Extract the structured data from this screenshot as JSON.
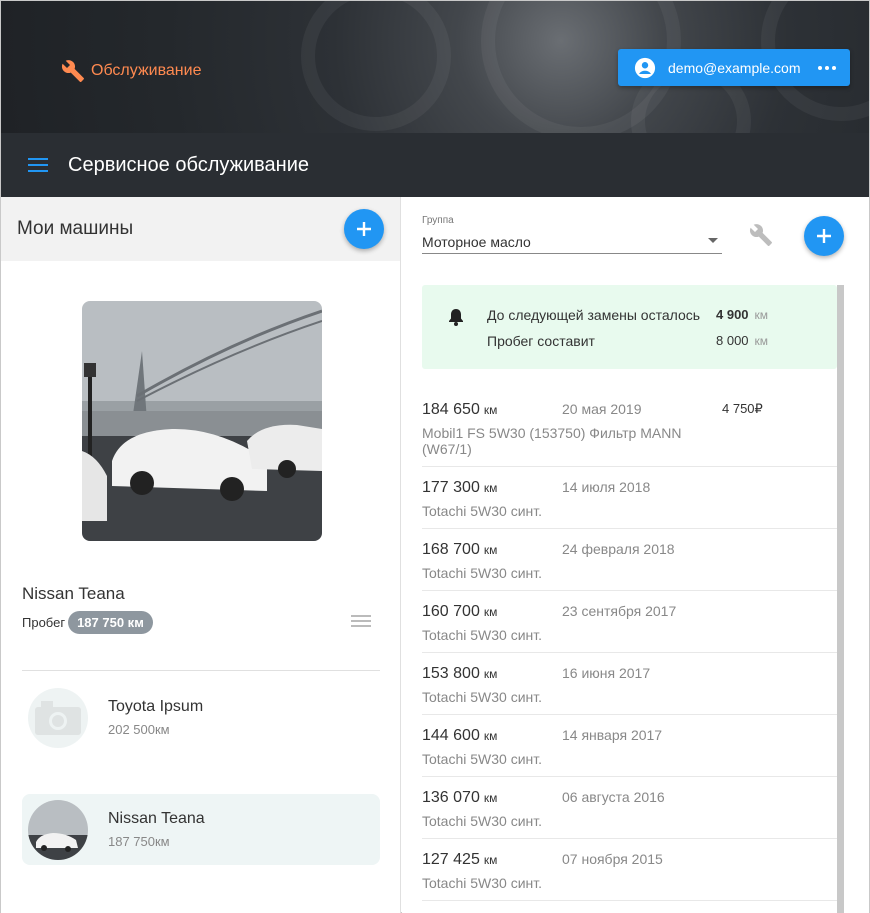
{
  "header": {
    "brand_label": "Обслуживание",
    "account_email": "demo@example.com"
  },
  "toolbar": {
    "title": "Сервисное обслуживание"
  },
  "cars_panel": {
    "title": "Мои машины",
    "current_car": {
      "name": "Nissan Teana",
      "mileage_label": "Пробег",
      "mileage_value": "187 750 км"
    },
    "list": [
      {
        "name": "Toyota Ipsum",
        "mileage": "202 500км",
        "selected": false
      },
      {
        "name": "Nissan Teana",
        "mileage": "187 750км",
        "selected": true
      }
    ]
  },
  "service_panel": {
    "group_label": "Группа",
    "group_value": "Моторное масло",
    "notice": {
      "line1_label": "До следующей замены осталось",
      "line1_value": "4 900",
      "line2_label": "Пробег составит",
      "line2_value": "8 000",
      "unit": "км"
    },
    "km_unit": "км",
    "records": [
      {
        "km": "184 650",
        "date": "20 мая 2019",
        "price": "4 750₽",
        "desc": "Mobil1 FS 5W30 (153750) Фильтр MANN (W67/1)"
      },
      {
        "km": "177 300",
        "date": "14 июля 2018",
        "price": "",
        "desc": "Totachi 5W30 синт."
      },
      {
        "km": "168 700",
        "date": "24 февраля 2018",
        "price": "",
        "desc": "Totachi 5W30 синт."
      },
      {
        "km": "160 700",
        "date": "23 сентября 2017",
        "price": "",
        "desc": "Totachi 5W30 синт."
      },
      {
        "km": "153 800",
        "date": "16 июня 2017",
        "price": "",
        "desc": "Totachi 5W30 синт."
      },
      {
        "km": "144 600",
        "date": "14 января 2017",
        "price": "",
        "desc": "Totachi 5W30 синт."
      },
      {
        "km": "136 070",
        "date": "06 августа 2016",
        "price": "",
        "desc": "Totachi 5W30 синт."
      },
      {
        "km": "127 425",
        "date": "07 ноября 2015",
        "price": "",
        "desc": "Totachi 5W30 синт."
      }
    ]
  },
  "icons": {
    "brand": "wrench-icon",
    "account": "account-circle-icon",
    "more": "more-horizontal-icon",
    "menu": "menu-icon",
    "add": "plus-icon",
    "list": "list-icon",
    "camera": "camera-icon",
    "bell": "bell-icon",
    "settings": "wrench-icon"
  },
  "colors": {
    "accent": "#2196f3",
    "brand_orange": "#ff8a50",
    "toolbar": "#2a2e33",
    "notice_bg": "#e8faee"
  }
}
